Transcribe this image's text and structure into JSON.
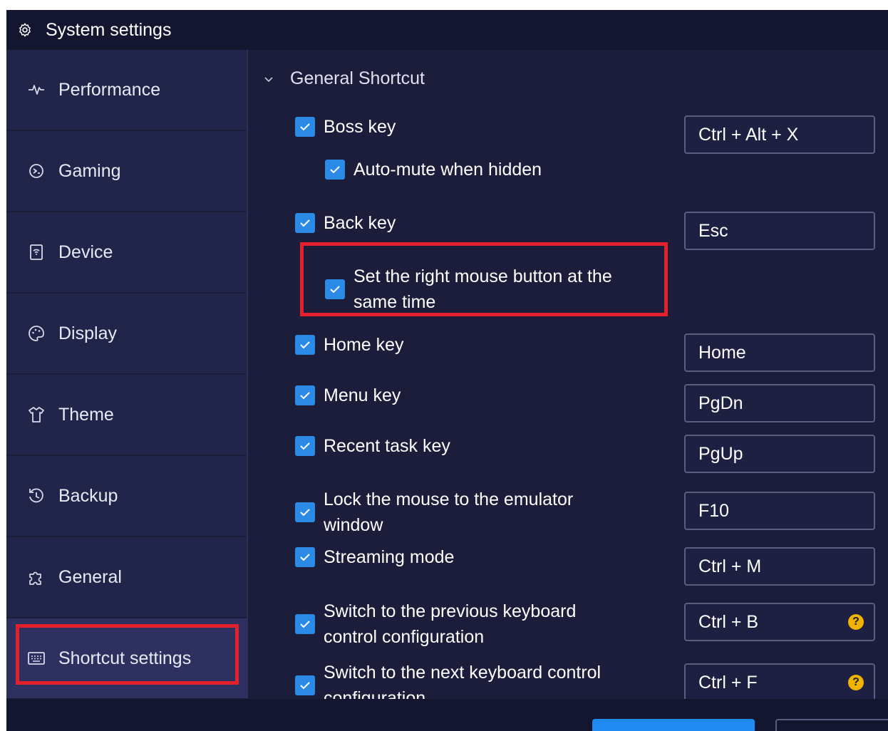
{
  "window": {
    "title": "System settings",
    "title_icon": "gear-icon"
  },
  "sidebar": {
    "items": [
      {
        "id": "performance",
        "label": "Performance",
        "icon": "pulse-icon"
      },
      {
        "id": "gaming",
        "label": "Gaming",
        "icon": "gamepad-icon"
      },
      {
        "id": "device",
        "label": "Device",
        "icon": "device-icon"
      },
      {
        "id": "display",
        "label": "Display",
        "icon": "palette-icon"
      },
      {
        "id": "theme",
        "label": "Theme",
        "icon": "shirt-icon"
      },
      {
        "id": "backup",
        "label": "Backup",
        "icon": "history-icon"
      },
      {
        "id": "general",
        "label": "General",
        "icon": "puzzle-icon"
      },
      {
        "id": "shortcut",
        "label": "Shortcut settings",
        "icon": "keyboard-icon",
        "active": true
      }
    ]
  },
  "main": {
    "section": {
      "label": "General Shortcut",
      "expanded": true
    },
    "shortcuts": [
      {
        "id": "boss",
        "label": "Boss key",
        "checked": true,
        "key": "Ctrl + Alt + X"
      },
      {
        "id": "automute",
        "label": "Auto-mute when hidden",
        "checked": true,
        "sub": true
      },
      {
        "id": "back",
        "label": "Back key",
        "checked": true,
        "key": "Esc"
      },
      {
        "id": "rightmouse",
        "label_line1": "Set the right mouse button at the",
        "label_line2": "same time",
        "checked": true,
        "sub": true,
        "highlighted": true
      },
      {
        "id": "home",
        "label": "Home key",
        "checked": true,
        "key": "Home"
      },
      {
        "id": "menu",
        "label": "Menu key",
        "checked": true,
        "key": "PgDn"
      },
      {
        "id": "recent",
        "label": "Recent task key",
        "checked": true,
        "key": "PgUp"
      },
      {
        "id": "lock",
        "label_line1": "Lock the mouse to the emulator",
        "label_line2": "window",
        "checked": true,
        "key": "F10"
      },
      {
        "id": "streaming",
        "label": "Streaming mode",
        "checked": true,
        "key": "Ctrl + M"
      },
      {
        "id": "prevkb",
        "label_line1": "Switch to the previous keyboard",
        "label_line2": "control configuration",
        "checked": true,
        "key": "Ctrl + B",
        "help": "?"
      },
      {
        "id": "nextkb",
        "label_line1": "Switch to the next keyboard control",
        "label_line2": "configuration",
        "checked": true,
        "key": "Ctrl + F",
        "help": "?"
      }
    ]
  },
  "colors": {
    "background": "#1b1d3a",
    "sidebar": "#22254a",
    "checkbox": "#2a8ae6",
    "highlight": "#e3202b",
    "help_badge": "#f0b400"
  }
}
